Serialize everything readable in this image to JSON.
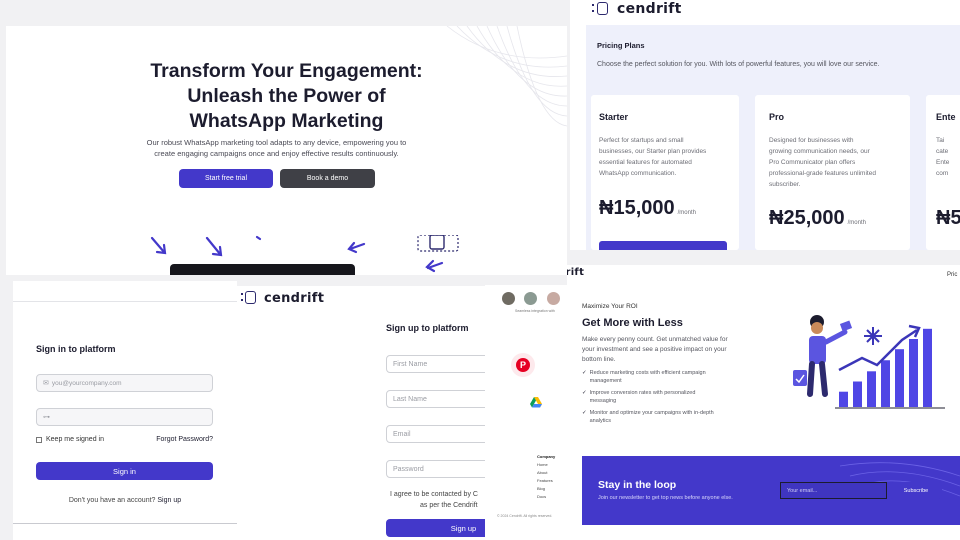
{
  "hero": {
    "title_l1": "Transform Your Engagement:",
    "title_l2": "Unleash the Power of",
    "title_l3": "WhatsApp Marketing",
    "desc_l1": "Our robust WhatsApp marketing tool adapts to any device, empowering you to",
    "desc_l2": "create engaging campaigns once and enjoy effective results continuously.",
    "cta_primary": "Start free trial",
    "cta_secondary": "Book a demo"
  },
  "pricing": {
    "brand": "cendrift",
    "section_title": "Pricing Plans",
    "section_subtitle": "Choose the perfect solution for you. With lots of powerful features, you will love our service.",
    "plans": [
      {
        "name": "Starter",
        "desc_l1": "Perfect for startups and small",
        "desc_l2": "businesses, our Starter plan provides",
        "desc_l3": "essential features for automated",
        "desc_l4": "WhatsApp communication.",
        "price": "₦15,000",
        "unit": "/month"
      },
      {
        "name": "Pro",
        "desc_l1": "Designed for businesses with",
        "desc_l2": "growing communication needs, our",
        "desc_l3": "Pro Communicator plan offers",
        "desc_l4": "professional-grade features unlimited",
        "desc_l5": "subscriber.",
        "price": "₦25,000",
        "unit": "/month"
      },
      {
        "name": "Ente",
        "desc_l1": "Tai",
        "desc_l2": "cate",
        "desc_l3": "Ente",
        "desc_l4": "com",
        "price": "₦5",
        "unit": ""
      }
    ]
  },
  "signin": {
    "title": "Sign in to platform",
    "email_placeholder": "you@yourcompany.com",
    "remember_label": "Keep me signed in",
    "forgot": "Forgot Password?",
    "submit": "Sign in",
    "footer_text": "Don't you have an account?",
    "footer_link": "Sign up"
  },
  "signup": {
    "brand": "cendrift",
    "title": "Sign up to platform",
    "first_name": "First Name",
    "last_name": "Last Name",
    "email": "Email",
    "password": "Password",
    "consent_l1": "I agree to be contacted by C",
    "consent_l2": "as per the Cendrift",
    "submit": "Sign up"
  },
  "integrations": {
    "caption": "Seamless integration with",
    "footer_heading": "Company",
    "footer_links": [
      "Home",
      "About",
      "Features",
      "Blog",
      "Docs"
    ],
    "copyright": "© 2024 Cendrift. All rights reserved.",
    "swatch_colors": [
      "#6f6b62",
      "#8b9a92",
      "#c7aaa2",
      "#c9b3b5",
      "#9aa3ab"
    ]
  },
  "roi": {
    "brand_partial": "drift",
    "nav_partial": "Pric",
    "eyebrow": "Maximize Your ROI",
    "title": "Get More with Less",
    "desc_l1": "Make every penny count. Get unmatched value for",
    "desc_l2": "your investment and see a positive impact on your",
    "desc_l3": "bottom line.",
    "bullets": [
      {
        "l1": "Reduce marketing costs with efficient campaign",
        "l2": "management"
      },
      {
        "l1": "Improve conversion rates with personalized",
        "l2": "messaging"
      },
      {
        "l1": "Monitor and optimize your campaigns with in-depth",
        "l2": "analytics"
      }
    ],
    "chart_bars": [
      0.18,
      0.3,
      0.42,
      0.55,
      0.68,
      0.8,
      0.92
    ]
  },
  "newsletter": {
    "title": "Stay in the loop",
    "subtitle": "Join our newsletter to get top news before anyone else.",
    "placeholder": "Your email...",
    "submit": "Subscribe"
  },
  "colors": {
    "accent": "#4338ca",
    "dark": "#3f4046",
    "brand_navy": "#2d2a6e",
    "pricing_bg": "#eef0fb"
  }
}
